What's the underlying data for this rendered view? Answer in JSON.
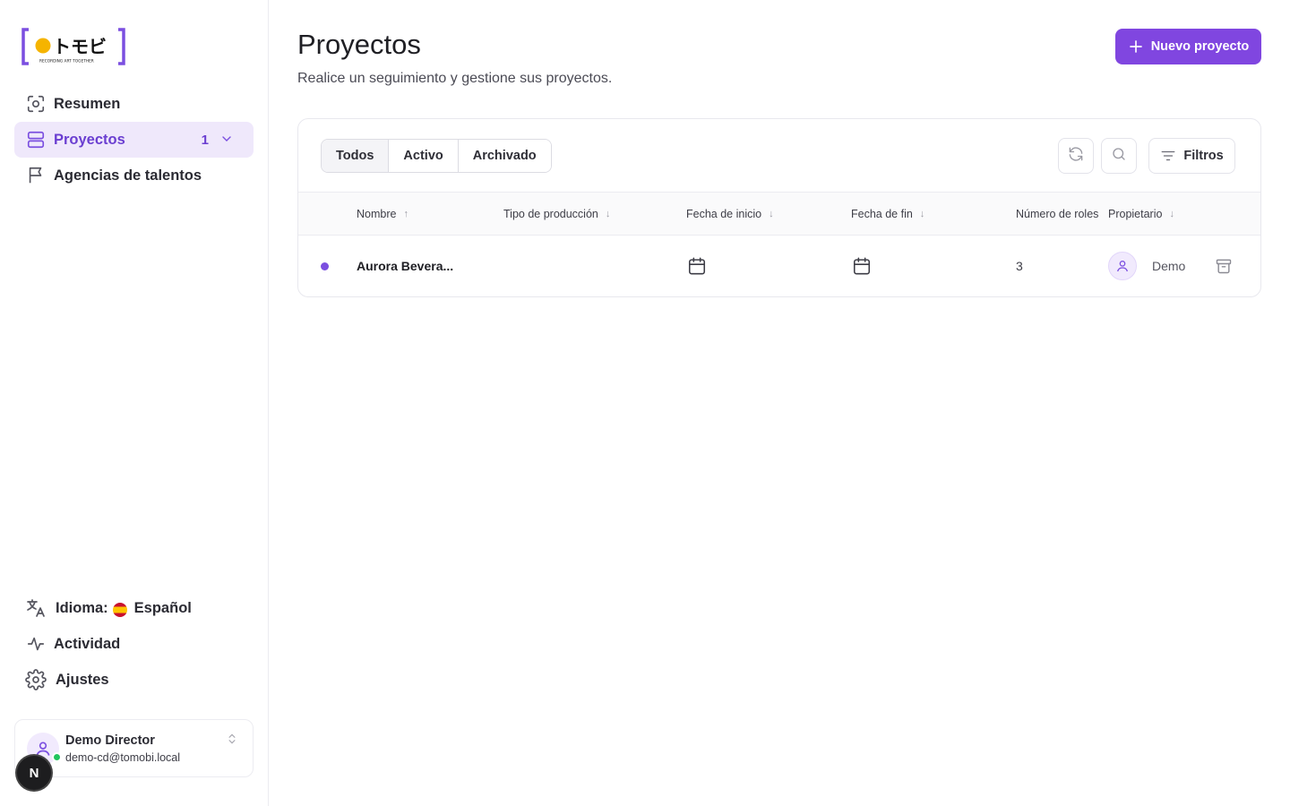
{
  "brand": {
    "logo_text": "トモビ",
    "logo_tagline": "RECORDING ART TOGETHER",
    "accent": "#8046e0",
    "logo_dot_color": "#f5b400"
  },
  "sidebar": {
    "items": [
      {
        "label": "Resumen",
        "icon": "scan-icon"
      },
      {
        "label": "Proyectos",
        "icon": "stack-icon",
        "count": "1",
        "active": true
      },
      {
        "label": "Agencias de talentos",
        "icon": "flag-icon"
      }
    ],
    "bottom": {
      "language_label": "Idioma:",
      "language_value": "Español",
      "activity_label": "Actividad",
      "settings_label": "Ajustes"
    },
    "user": {
      "name": "Demo Director",
      "email": "demo-cd@tomobi.local",
      "status": "online"
    },
    "dev_badge": "N"
  },
  "main": {
    "title": "Proyectos",
    "subtitle": "Realice un seguimiento y gestione sus proyectos.",
    "new_button_label": "Nuevo proyecto",
    "tabs": [
      {
        "label": "Todos",
        "active": true
      },
      {
        "label": "Activo"
      },
      {
        "label": "Archivado"
      }
    ],
    "filters_label": "Filtros",
    "table": {
      "columns": [
        "Nombre",
        "Tipo de producción",
        "Fecha de inicio",
        "Fecha de fin",
        "Número de roles",
        "Propietario"
      ],
      "sort_arrows": {
        "name": "↑",
        "default": "↓"
      },
      "rows": [
        {
          "status_color": "#7b4fe0",
          "name": "Aurora Bevera...",
          "production_type": "",
          "start_date_icon": "calendar-icon",
          "end_date_icon": "calendar-icon",
          "roles": "3",
          "owner": "Demo"
        }
      ]
    }
  }
}
